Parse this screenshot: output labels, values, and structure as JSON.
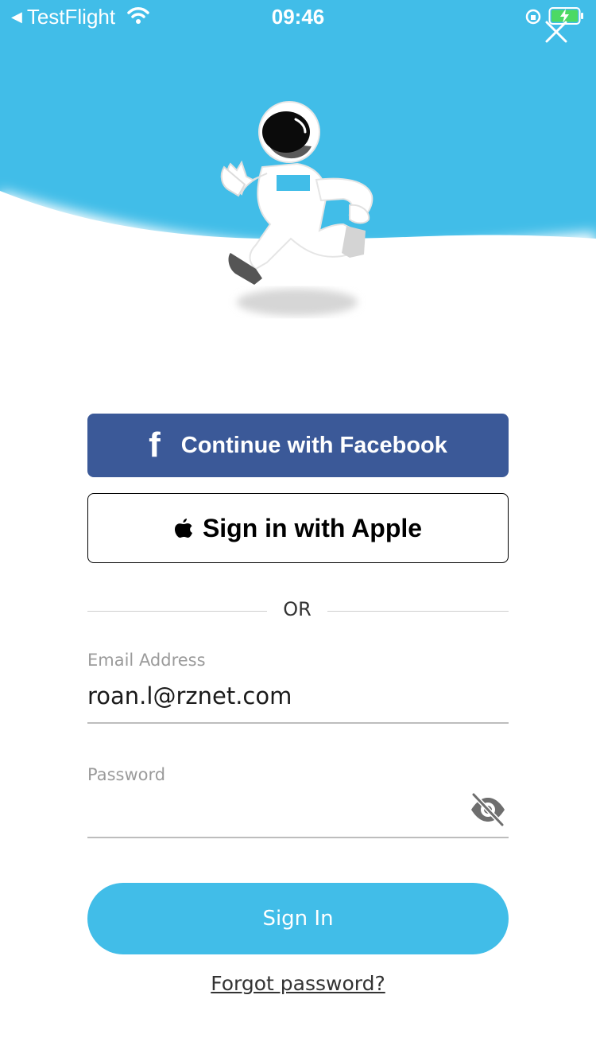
{
  "status_bar": {
    "back_app": "TestFlight",
    "time": "09:46"
  },
  "colors": {
    "sky": "#41bde8",
    "facebook": "#3b5998",
    "sign_in": "#41bde8"
  },
  "social": {
    "facebook_icon": "f",
    "facebook_label": "Continue with Facebook",
    "apple_label": "Sign in with Apple"
  },
  "divider": {
    "text": "OR"
  },
  "form": {
    "email_label": "Email Address",
    "email_value": "roan.l@rznet.com",
    "password_label": "Password",
    "password_value": ""
  },
  "actions": {
    "sign_in_label": "Sign In",
    "forgot_label": "Forgot password?"
  },
  "icons": {
    "close": "close-icon",
    "password_toggle": "eye-slash-icon",
    "apple": "apple-logo-icon",
    "facebook": "facebook-logo-icon"
  }
}
